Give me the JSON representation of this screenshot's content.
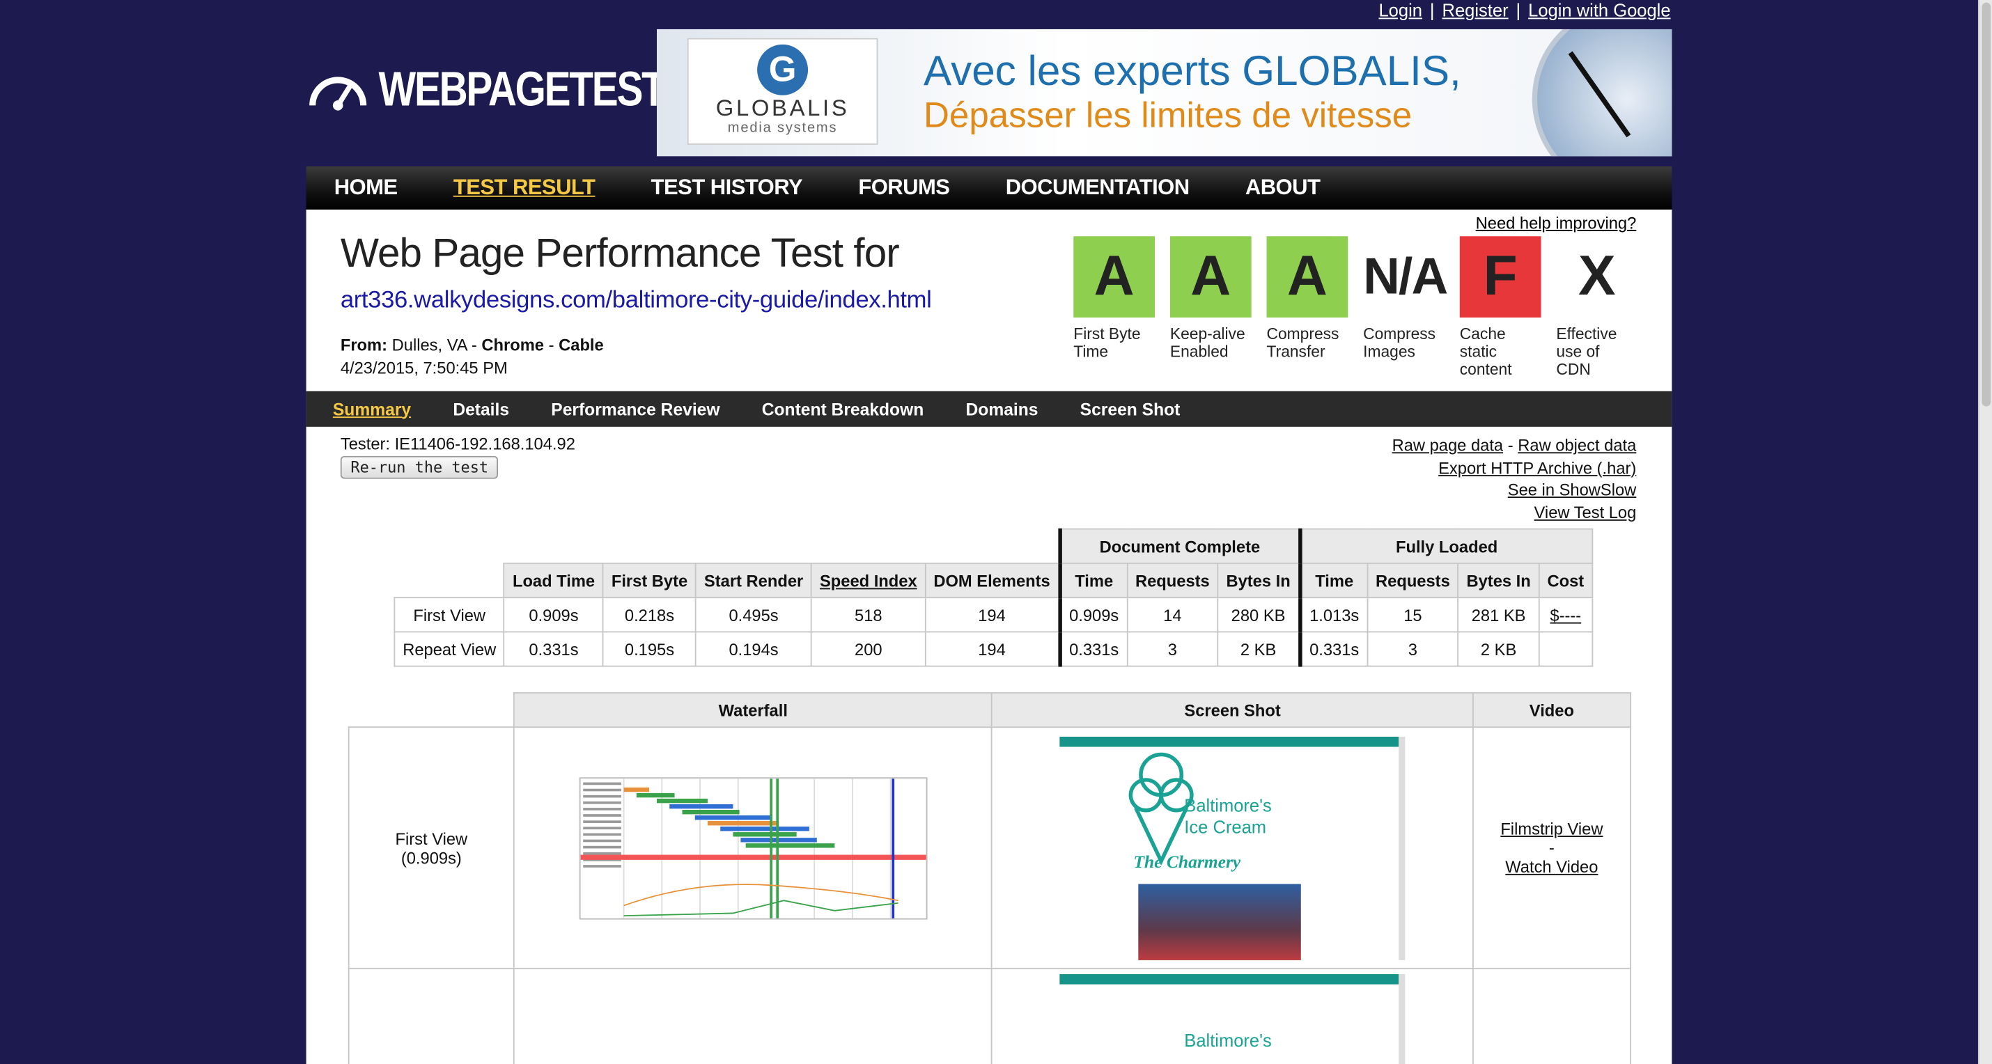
{
  "top_links": {
    "login": "Login",
    "register": "Register",
    "login_google": "Login with Google",
    "sep": "|"
  },
  "logo": {
    "text": "WEBPAGETEST"
  },
  "banner": {
    "brand": "GLOBALIS",
    "brand_sub": "media systems",
    "line1": "Avec les experts GLOBALIS,",
    "line2": "Dépasser les limites de vitesse"
  },
  "nav": {
    "items": [
      "HOME",
      "TEST RESULT",
      "TEST HISTORY",
      "FORUMS",
      "DOCUMENTATION",
      "ABOUT"
    ],
    "active": "TEST RESULT"
  },
  "header": {
    "need_help": "Need help improving?",
    "title": "Web Page Performance Test for",
    "url": "art336.walkydesigns.com/baltimore-city-guide/index.html",
    "from_label": "From:",
    "from_location": "Dulles, VA -",
    "from_browser": "Chrome",
    "from_dash": "-",
    "from_connection": "Cable",
    "date": "4/23/2015, 7:50:45 PM"
  },
  "grades": [
    {
      "grade": "A",
      "label": "First Byte Time",
      "color": "#8fcf4f"
    },
    {
      "grade": "A",
      "label": "Keep-alive Enabled",
      "color": "#8fcf4f"
    },
    {
      "grade": "A",
      "label": "Compress Transfer",
      "color": "#8fcf4f"
    },
    {
      "grade": "N/A",
      "label": "Compress Images",
      "color": "#ffffff"
    },
    {
      "grade": "F",
      "label": "Cache static content",
      "color": "#e8373a"
    },
    {
      "grade": "X",
      "label": "Effective use of CDN",
      "color": "#ffffff"
    }
  ],
  "subnav": {
    "items": [
      "Summary",
      "Details",
      "Performance Review",
      "Content Breakdown",
      "Domains",
      "Screen Shot"
    ],
    "active": "Summary"
  },
  "tester": "Tester: IE11406-192.168.104.92",
  "rerun_label": "Re-run the test",
  "raw_links": {
    "raw_page": "Raw page data",
    "dash": "-",
    "raw_object": "Raw object data",
    "export_har": "Export HTTP Archive (.har)",
    "showslow": "See in ShowSlow",
    "test_log": "View Test Log"
  },
  "results": {
    "group_headers": {
      "document_complete": "Document Complete",
      "fully_loaded": "Fully Loaded"
    },
    "columns": {
      "load_time": "Load Time",
      "first_byte": "First Byte",
      "start_render": "Start Render",
      "speed_index": "Speed Index",
      "dom_elements": "DOM Elements",
      "dc_time": "Time",
      "dc_requests": "Requests",
      "dc_bytes": "Bytes In",
      "fl_time": "Time",
      "fl_requests": "Requests",
      "fl_bytes": "Bytes In",
      "cost": "Cost"
    },
    "rows": [
      {
        "label": "First View",
        "load_time": "0.909s",
        "first_byte": "0.218s",
        "start_render": "0.495s",
        "speed_index": "518",
        "dom_elements": "194",
        "dc_time": "0.909s",
        "dc_requests": "14",
        "dc_bytes": "280 KB",
        "fl_time": "1.013s",
        "fl_requests": "15",
        "fl_bytes": "281 KB",
        "cost": "$----"
      },
      {
        "label": "Repeat View",
        "load_time": "0.331s",
        "first_byte": "0.195s",
        "start_render": "0.194s",
        "speed_index": "200",
        "dom_elements": "194",
        "dc_time": "0.331s",
        "dc_requests": "3",
        "dc_bytes": "2 KB",
        "fl_time": "0.331s",
        "fl_requests": "3",
        "fl_bytes": "2 KB",
        "cost": ""
      }
    ]
  },
  "media": {
    "headers": {
      "waterfall": "Waterfall",
      "screen_shot": "Screen Shot",
      "video": "Video"
    },
    "first_view_label": "First View",
    "first_view_time": "(0.909s)",
    "filmstrip": "Filmstrip View",
    "dash": "-",
    "watch_video": "Watch Video",
    "screenshot_title1": "Baltimore's",
    "screenshot_title2": "Ice Cream",
    "screenshot_script": "The Charmery"
  },
  "colors": {
    "page_bg": "#1c1a4e",
    "accent": "#f6c844",
    "link_blue": "#1a1aa6"
  }
}
